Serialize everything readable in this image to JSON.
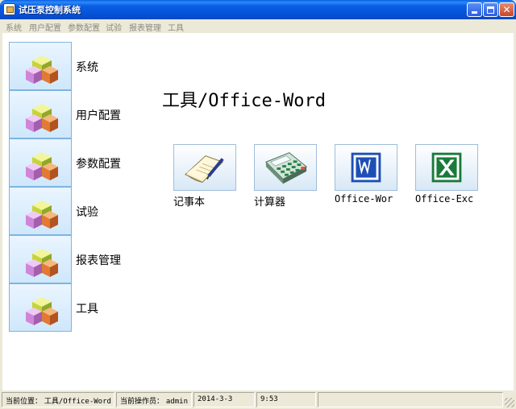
{
  "window": {
    "title": "试压泵控制系统"
  },
  "menu": [
    "系统",
    "用户配置",
    "参数配置",
    "试验",
    "报表管理",
    "工具"
  ],
  "nav": [
    {
      "label": "系统"
    },
    {
      "label": "用户配置"
    },
    {
      "label": "参数配置"
    },
    {
      "label": "试验"
    },
    {
      "label": "报表管理"
    },
    {
      "label": "工具"
    }
  ],
  "main": {
    "heading": "工具/Office-Word",
    "tools": [
      {
        "label": "记事本",
        "icon": "notepad-icon"
      },
      {
        "label": "计算器",
        "icon": "calculator-icon"
      },
      {
        "label": "Office-Wor",
        "icon": "word-icon"
      },
      {
        "label": "Office-Exc",
        "icon": "excel-icon"
      }
    ]
  },
  "status": {
    "location_label": "当前位置：",
    "location_value": "工具/Office-Word",
    "operator_label": "当前操作员：",
    "operator_value": "admin",
    "date": "2014-3-3",
    "time": "9:53"
  },
  "colors": {
    "titlebar": "#0A5FE6",
    "background": "#ECE9D8",
    "nav_button": "#cfe7fb",
    "word_blue": "#1d4fb5",
    "excel_green": "#1a7a3a"
  }
}
